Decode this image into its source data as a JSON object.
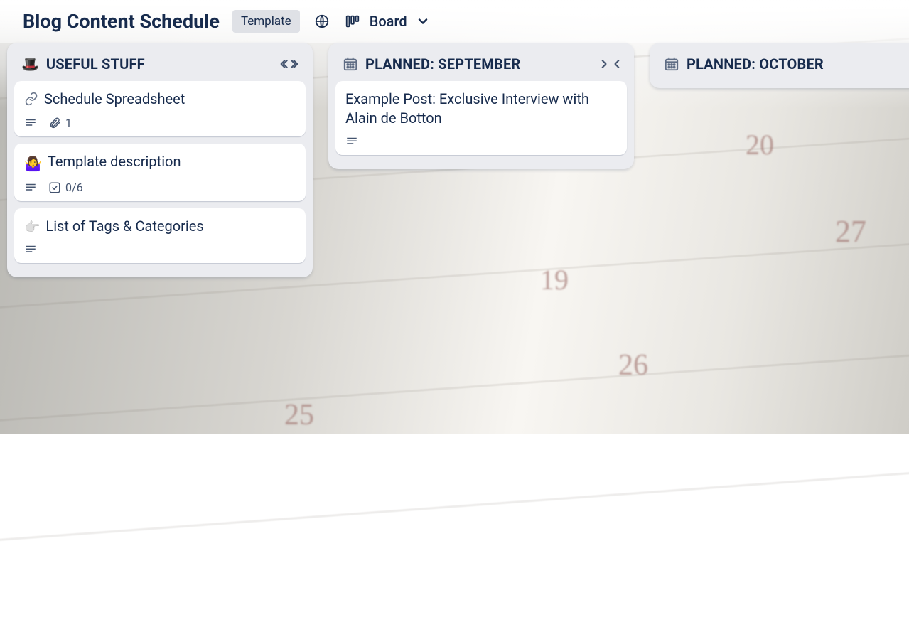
{
  "header": {
    "title": "Blog Content Schedule",
    "template_badge": "Template",
    "view_label": "Board"
  },
  "bg_numbers": [
    "20",
    "27",
    "19",
    "26",
    "25"
  ],
  "lists": [
    {
      "icon": "🎩",
      "title": "USEFUL STUFF",
      "cards": [
        {
          "lead_icon": "link",
          "title": "Schedule Spreadsheet",
          "badges": {
            "description": true,
            "attachments": "1"
          }
        },
        {
          "lead_emoji": "🤷‍♀️",
          "title": "Template description",
          "badges": {
            "description": true,
            "checklist": "0/6"
          }
        },
        {
          "lead_emoji": "👉",
          "title": "List of Tags & Categories",
          "badges": {
            "description": true
          }
        }
      ]
    },
    {
      "icon": "calendar",
      "title": "PLANNED: SEPTEMBER",
      "cards": [
        {
          "title": "Example Post: Exclusive Interview with Alain de Botton",
          "badges": {
            "description": true
          }
        }
      ]
    },
    {
      "icon": "calendar",
      "title": "PLANNED: OCTOBER",
      "cards": []
    }
  ]
}
